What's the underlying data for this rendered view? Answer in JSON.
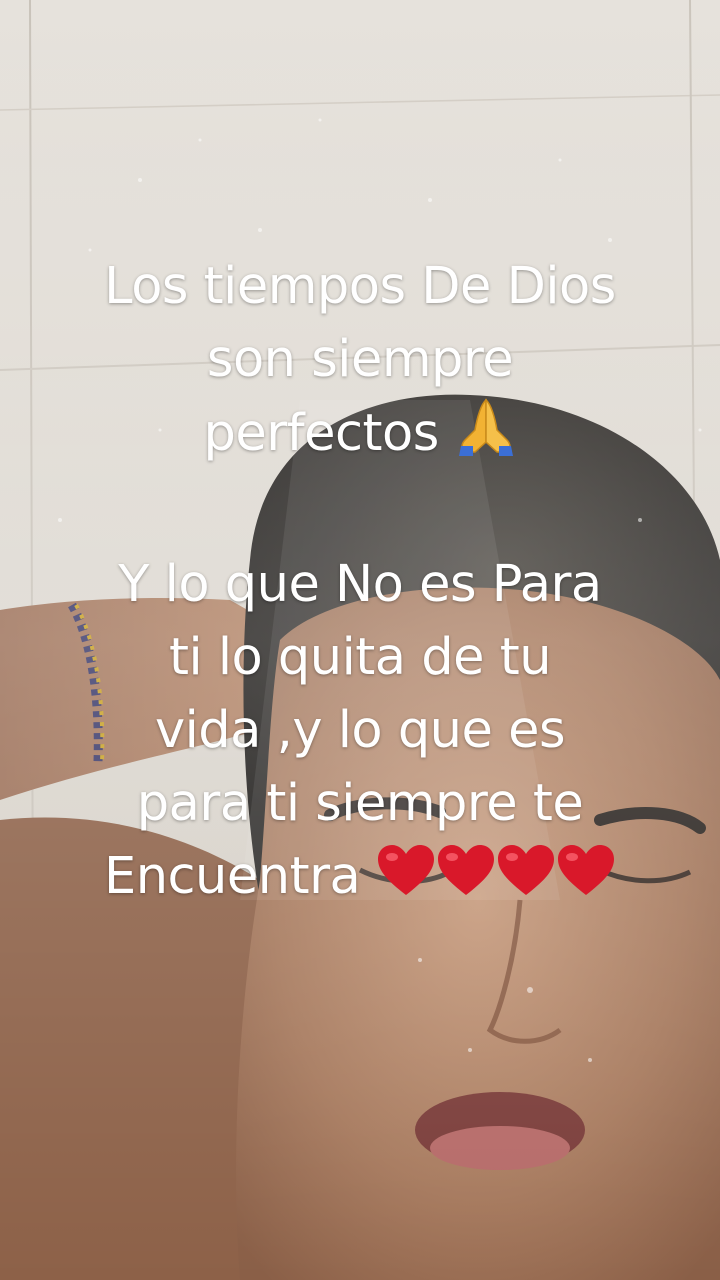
{
  "caption": {
    "block1_line1": "Los tiempos De Dios",
    "block1_line2": "son siempre",
    "block1_line3": "perfectos",
    "block2_line1": "Y lo que No es Para",
    "block2_line2": "ti lo quita de tu",
    "block2_line3": "vida ,y lo que es",
    "block2_line4": "para ti siempre te",
    "block2_line5": "Encuentra"
  },
  "icons": {
    "praying_hands": "praying-hands-emoji",
    "heart": "red-heart-emoji"
  },
  "colors": {
    "text": "#ffffff",
    "heart": "#d9182a",
    "hands": "#f2b233",
    "sleeve": "#3b6fd6"
  }
}
